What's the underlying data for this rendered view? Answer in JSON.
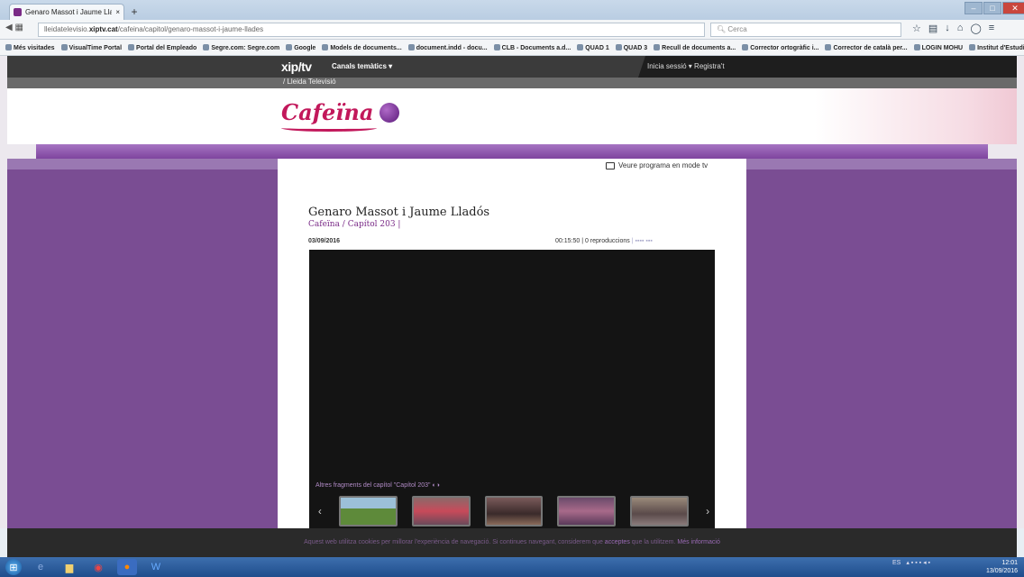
{
  "browser": {
    "tab_title": "Genaro Massot i Jaume Lla...",
    "new_tab": "+",
    "url_prefix": "lleidatelevisio.",
    "url_domain": "xiptv.cat",
    "url_path": "/cafeina/capitol/genaro-massot-i-jaume-llades",
    "search_placeholder": "Cerca",
    "bookmarks": [
      "Més visitades",
      "VisualTime Portal",
      "Portal del Empleado",
      "Segre.com: Segre.com",
      "Google",
      "Models de documents...",
      "document.indd - docu...",
      "CLB - Documents a.d...",
      "QUAD 1",
      "QUAD 3",
      "Recull de documents a...",
      "Corrector ortogràfic i...",
      "Corrector de català per...",
      "LOGIN MOHU",
      "Institut d'Estudis Ilerde..."
    ]
  },
  "site": {
    "logo": "xip/tv",
    "canals": "Canals temàtics",
    "inicia": "Inicia sessió  ▾  Registra't",
    "channel": "/ Lleida Televisió",
    "program_logo": "Cafeïna",
    "mode_tv": "Veure programa en mode tv"
  },
  "video": {
    "title": "Genaro Massot i Jaume Lladós",
    "breadcrumb": "Cafeïna / Capítol 203 |",
    "date": "03/09/2016",
    "duration": "00:15:50",
    "plays": "0 reproduccions",
    "fragments_label": "Altres fragments del capítol \"Capítol 203\""
  },
  "cookie": {
    "text": "Aquest web utilitza cookies per millorar l'experiència de navegació. Si continues navegant, considerem que",
    "accept": "acceptes",
    "text2": "que la utilitzem.",
    "more": "Més informació"
  },
  "taskbar": {
    "time": "12:01",
    "date": "13/09/2016",
    "lang": "ES"
  },
  "colors": {
    "brand_purple": "#7a4d93",
    "cafeina_pink": "#c2185b"
  }
}
